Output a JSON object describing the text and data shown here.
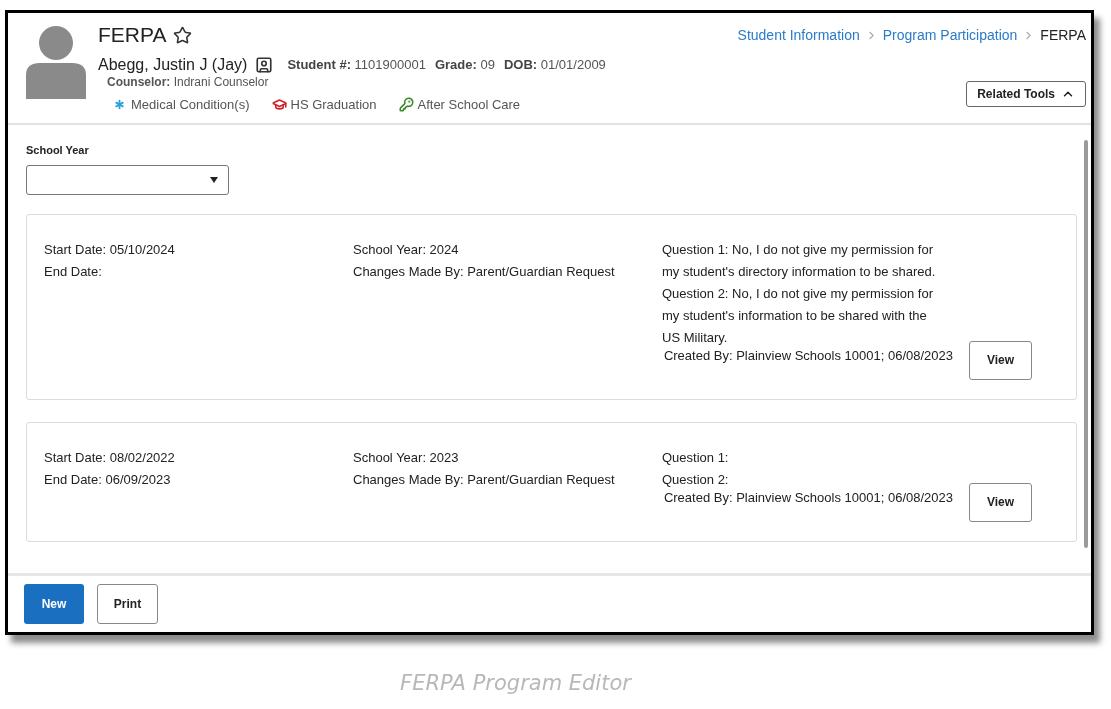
{
  "header": {
    "title": "FERPA",
    "breadcrumb": [
      {
        "label": "Student Information",
        "current": false
      },
      {
        "label": "Program Participation",
        "current": false
      },
      {
        "label": "FERPA",
        "current": true
      }
    ],
    "student": {
      "name": "Abegg, Justin J (Jay)",
      "fields": [
        {
          "label": "Student #:",
          "value": "1101900001"
        },
        {
          "label": "Grade:",
          "value": "09"
        },
        {
          "label": "DOB:",
          "value": "01/01/2009"
        }
      ],
      "counselor": {
        "label": "Counselor:",
        "value": "Indrani Counselor"
      }
    },
    "flags": [
      {
        "kind": "medical",
        "label": "Medical Condition(s)"
      },
      {
        "kind": "graduation",
        "label": "HS Graduation"
      },
      {
        "kind": "care",
        "label": "After School Care"
      }
    ],
    "related_tools": {
      "label": "Related Tools",
      "expanded": true
    }
  },
  "school_year": {
    "label": "School Year"
  },
  "records": [
    {
      "start_date": "Start Date: 05/10/2024",
      "end_date": "End Date:",
      "school_year": "School Year: 2024",
      "changes_made_by": "Changes Made By: Parent/Guardian Request",
      "questions": [
        "Question 1: No, I do not give my permission for my student's directory information to be shared.",
        "Question 2: No, I do not give my permission for my student's information to be shared with the US Military."
      ],
      "created_by": "Created By: Plainview Schools 10001; 06/08/2023",
      "view": "View"
    },
    {
      "start_date": "Start Date: 08/02/2022",
      "end_date": "End Date: 06/09/2023",
      "school_year": "School Year: 2023",
      "changes_made_by": "Changes Made By: Parent/Guardian Request",
      "questions": [
        "Question 1:",
        "Question 2:"
      ],
      "created_by": "Created By: Plainview Schools 10001; 06/08/2023",
      "view": "View"
    }
  ],
  "buttons": [
    {
      "label": "New",
      "kind": "primary"
    },
    {
      "label": "Print",
      "kind": "secondary"
    }
  ],
  "caption": "FERPA Program Editor"
}
